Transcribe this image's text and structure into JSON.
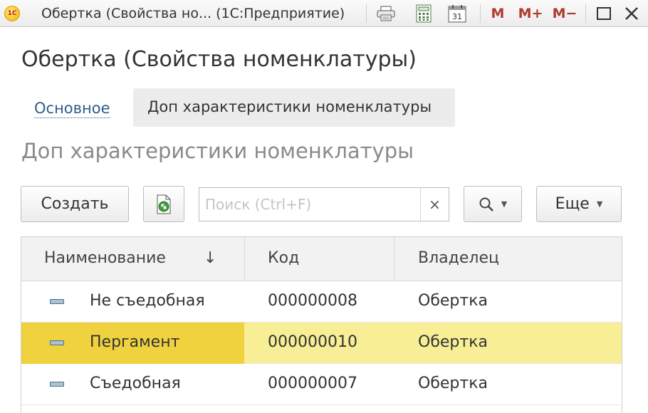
{
  "window": {
    "logo_text": "1С",
    "title": "Обертка (Свойства но...   (1С:Предприятие)",
    "toolbar_icons": [
      "print-icon",
      "calculator-icon",
      "calendar-icon"
    ],
    "calendar_day": "31",
    "memory_buttons": [
      "M",
      "M+",
      "M−"
    ]
  },
  "form": {
    "title": "Обертка (Свойства номенклатуры)",
    "tabs": [
      {
        "label": "Основное",
        "active": false
      },
      {
        "label": "Доп характеристики номенклатуры",
        "active": true
      }
    ],
    "section_title": "Доп характеристики номенклатуры"
  },
  "toolbar": {
    "create_label": "Создать",
    "search_placeholder": "Поиск (Ctrl+F)",
    "search_value": "",
    "clear_symbol": "×",
    "more_label": "Еще"
  },
  "table": {
    "columns": [
      "Наименование",
      "Код",
      "Владелец"
    ],
    "sort_indicator": "↓",
    "rows": [
      {
        "name": "Не съедобная",
        "code": "000000008",
        "owner": "Обертка",
        "selected": false
      },
      {
        "name": "Пергамент",
        "code": "000000010",
        "owner": "Обертка",
        "selected": true
      },
      {
        "name": "Съедобная",
        "code": "000000007",
        "owner": "Обертка",
        "selected": false
      }
    ]
  },
  "colors": {
    "selected_row": "#f7ee96",
    "selected_cell": "#efd23e",
    "link": "#2e5d8a",
    "memory_buttons": "#b03a2e"
  }
}
